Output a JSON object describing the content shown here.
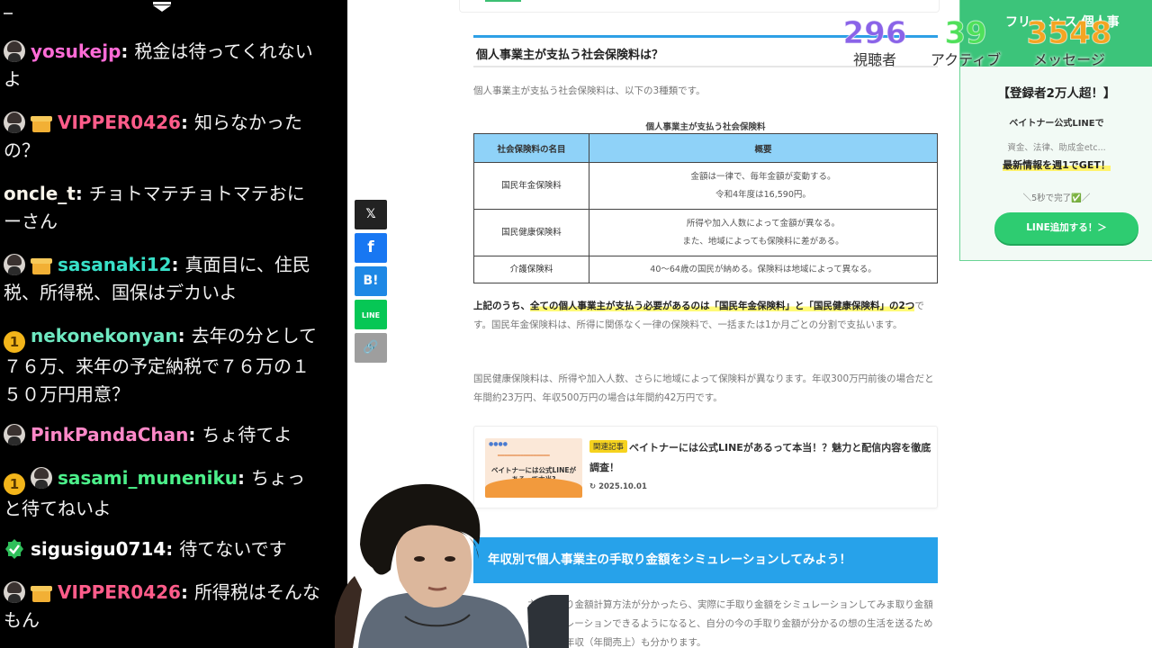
{
  "chat": {
    "messages": [
      {
        "user": "yosukejp",
        "user_color": "#ff6bd6",
        "badges": [
          "avatar"
        ],
        "text": "税金は待ってくれないよ"
      },
      {
        "user": "VIPPER0426",
        "user_color": "#ff5c8a",
        "badges": [
          "avatar",
          "gift"
        ],
        "text": "知らなかったの？"
      },
      {
        "user": "oncle_t",
        "user_color": "#f8f4ea",
        "badges": [],
        "text": "チョトマテチョトマテおにーさん"
      },
      {
        "user": "sasanaki12",
        "user_color": "#38e0c8",
        "badges": [
          "avatar",
          "gift"
        ],
        "text": "真面目に、住民税、所得税、国保はデカいよ"
      },
      {
        "user": "nekonekonyan",
        "user_color": "#6ee8c0",
        "badges": [
          "coin"
        ],
        "coin_label": "1",
        "text": "去年の分として７６万、来年の予定納税で７６万の１５０万円用意？"
      },
      {
        "user": "PinkPandaChan",
        "user_color": "#ff88c8",
        "badges": [
          "avatar"
        ],
        "text": "ちょ待てよ"
      },
      {
        "user": "sasami_muneniku",
        "user_color": "#4cf08a",
        "badges": [
          "coin",
          "avatar"
        ],
        "coin_label": "1",
        "text": "ちょっと待てねいよ"
      },
      {
        "user": "sigusigu0714",
        "user_color": "#ffffff",
        "badges": [
          "verified"
        ],
        "text": "待てないです"
      },
      {
        "user": "VIPPER0426",
        "user_color": "#ff5c8a",
        "badges": [
          "avatar",
          "gift"
        ],
        "text": "所得税はそんなもん"
      }
    ]
  },
  "share": {
    "buttons": [
      {
        "label": "𝕏",
        "icon": "x-icon",
        "color": "#222222"
      },
      {
        "label": "f",
        "icon": "facebook-icon",
        "color": "#1877f2"
      },
      {
        "label": "B!",
        "icon": "hatena-icon",
        "color": "#1e88e5"
      },
      {
        "label": "LINE",
        "icon": "line-icon",
        "color": "#06c755"
      },
      {
        "label": "🔗",
        "icon": "link-icon",
        "color": "#9e9e9e"
      }
    ]
  },
  "article": {
    "h3": "個人事業主が支払う社会保険料は？",
    "intro": "個人事業主が支払う社会保険料は、以下の3種類です。",
    "table": {
      "caption": "個人事業主が支払う社会保険料",
      "headers": [
        "社会保険料の名目",
        "概要"
      ],
      "rows": [
        {
          "name": "国民年金保険料",
          "lines": [
            "金額は一律で、毎年金額が変動する。",
            "令和4年度は16,590円。"
          ]
        },
        {
          "name": "国民健康保険料",
          "lines": [
            "所得や加入人数によって金額が異なる。",
            "また、地域によっても保険料に差がある。"
          ]
        },
        {
          "name": "介護保険料",
          "lines": [
            "40～64歳の国民が納める。保険料は地域によって異なる。"
          ]
        }
      ]
    },
    "para1_pre": "上記のうち、",
    "para1_hl": "全ての個人事業主が支払う必要があるのは「国民年金保険料」と「国民健康保険料」の2つ",
    "para1_post": "です。国民年金保険料は、所得に関係なく一律の保険料で、一括または1か月ごとの分割で支払います。",
    "para2": "国民健康保険料は、所得や加入人数、さらに地域によって保険料が異なります。年収300万円前後の場合だと年間約23万円、年収500万円の場合は年間約42万円です。",
    "related": {
      "tag": "関連記事",
      "title": "ベイトナーには公式LINEがあるって本当！？魅力と配信内容を徹底調査！",
      "date": "2025.10.01",
      "thumb_title": "ベイトナーには公式LINEがあるって本当?"
    },
    "h2": "年収別で個人事業主の手取り金額をシミュレーションしてみよう！",
    "para3": "主の手取り金額計算方法が分かったら、実際に手取り金額をシミュレーションしてみま取り金額がシミュレーションできるようになると、自分の今の手取り金額が分かるの想の生活を送るために必要な年収（年間売上）も分かります。"
  },
  "banner": {
    "head": "フリー ン ス 個人事",
    "registered": "【登録者2万人超！】",
    "official": "ベイトナー公式LINEで",
    "topics": "資金、法律、助成金etc...",
    "weekly": "最新情報を週1でGET！",
    "done": "＼5秒で完了✅／",
    "button": "LINE追加する！＞"
  },
  "stats": [
    {
      "value": "296",
      "label": "視聴者",
      "color": "#8a63e8"
    },
    {
      "value": "39",
      "label": "アクティブ",
      "color": "#4fe05a"
    },
    {
      "value": "3548",
      "label": "メッセージ",
      "color": "#f4a523"
    }
  ]
}
